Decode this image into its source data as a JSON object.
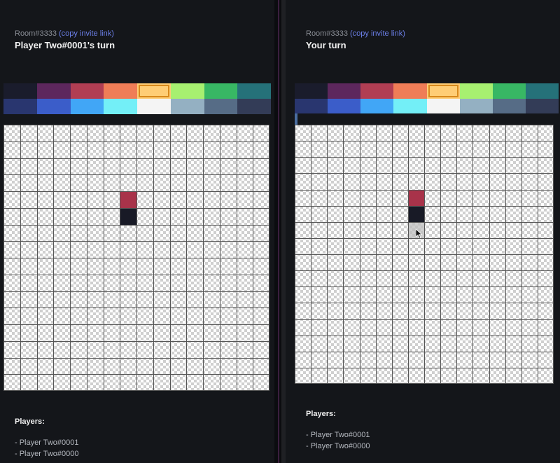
{
  "left_view": {
    "room_label": "Room#3333",
    "invite_link_label": "(copy invite link)",
    "turn_title": "Player Two#0001's turn",
    "turn_progress": 0,
    "players_heading": "Players:",
    "players": [
      "- Player Two#0001",
      "- Player Two#0000"
    ],
    "painted_cells": [
      {
        "col": 7,
        "row": 4,
        "color": "#a8334a"
      },
      {
        "col": 7,
        "row": 5,
        "color": "#181a26"
      }
    ]
  },
  "right_view": {
    "room_label": "Room#3333",
    "invite_link_label": "(copy invite link)",
    "turn_title": "Your turn",
    "turn_progress": 0.01,
    "players_heading": "Players:",
    "players": [
      "- Player Two#0001",
      "- Player Two#0000"
    ],
    "painted_cells": [
      {
        "col": 7,
        "row": 4,
        "color": "#a8334a"
      },
      {
        "col": 7,
        "row": 5,
        "color": "#181a26"
      }
    ],
    "hover_cell": {
      "col": 7,
      "row": 6
    }
  },
  "palette": {
    "selected_index": 4,
    "colors": [
      "#1a1c2c",
      "#5d275d",
      "#b13e53",
      "#ef7d57",
      "#ffcd75",
      "#a7f070",
      "#38b764",
      "#257179",
      "#29366f",
      "#3b5dc9",
      "#41a6f6",
      "#73eff7",
      "#f4f4f4",
      "#94b0c2",
      "#566c86",
      "#333c57"
    ]
  },
  "board": {
    "cols": 16,
    "rows": 16
  },
  "icons": {
    "cursor": "mouse-pointer-icon"
  }
}
